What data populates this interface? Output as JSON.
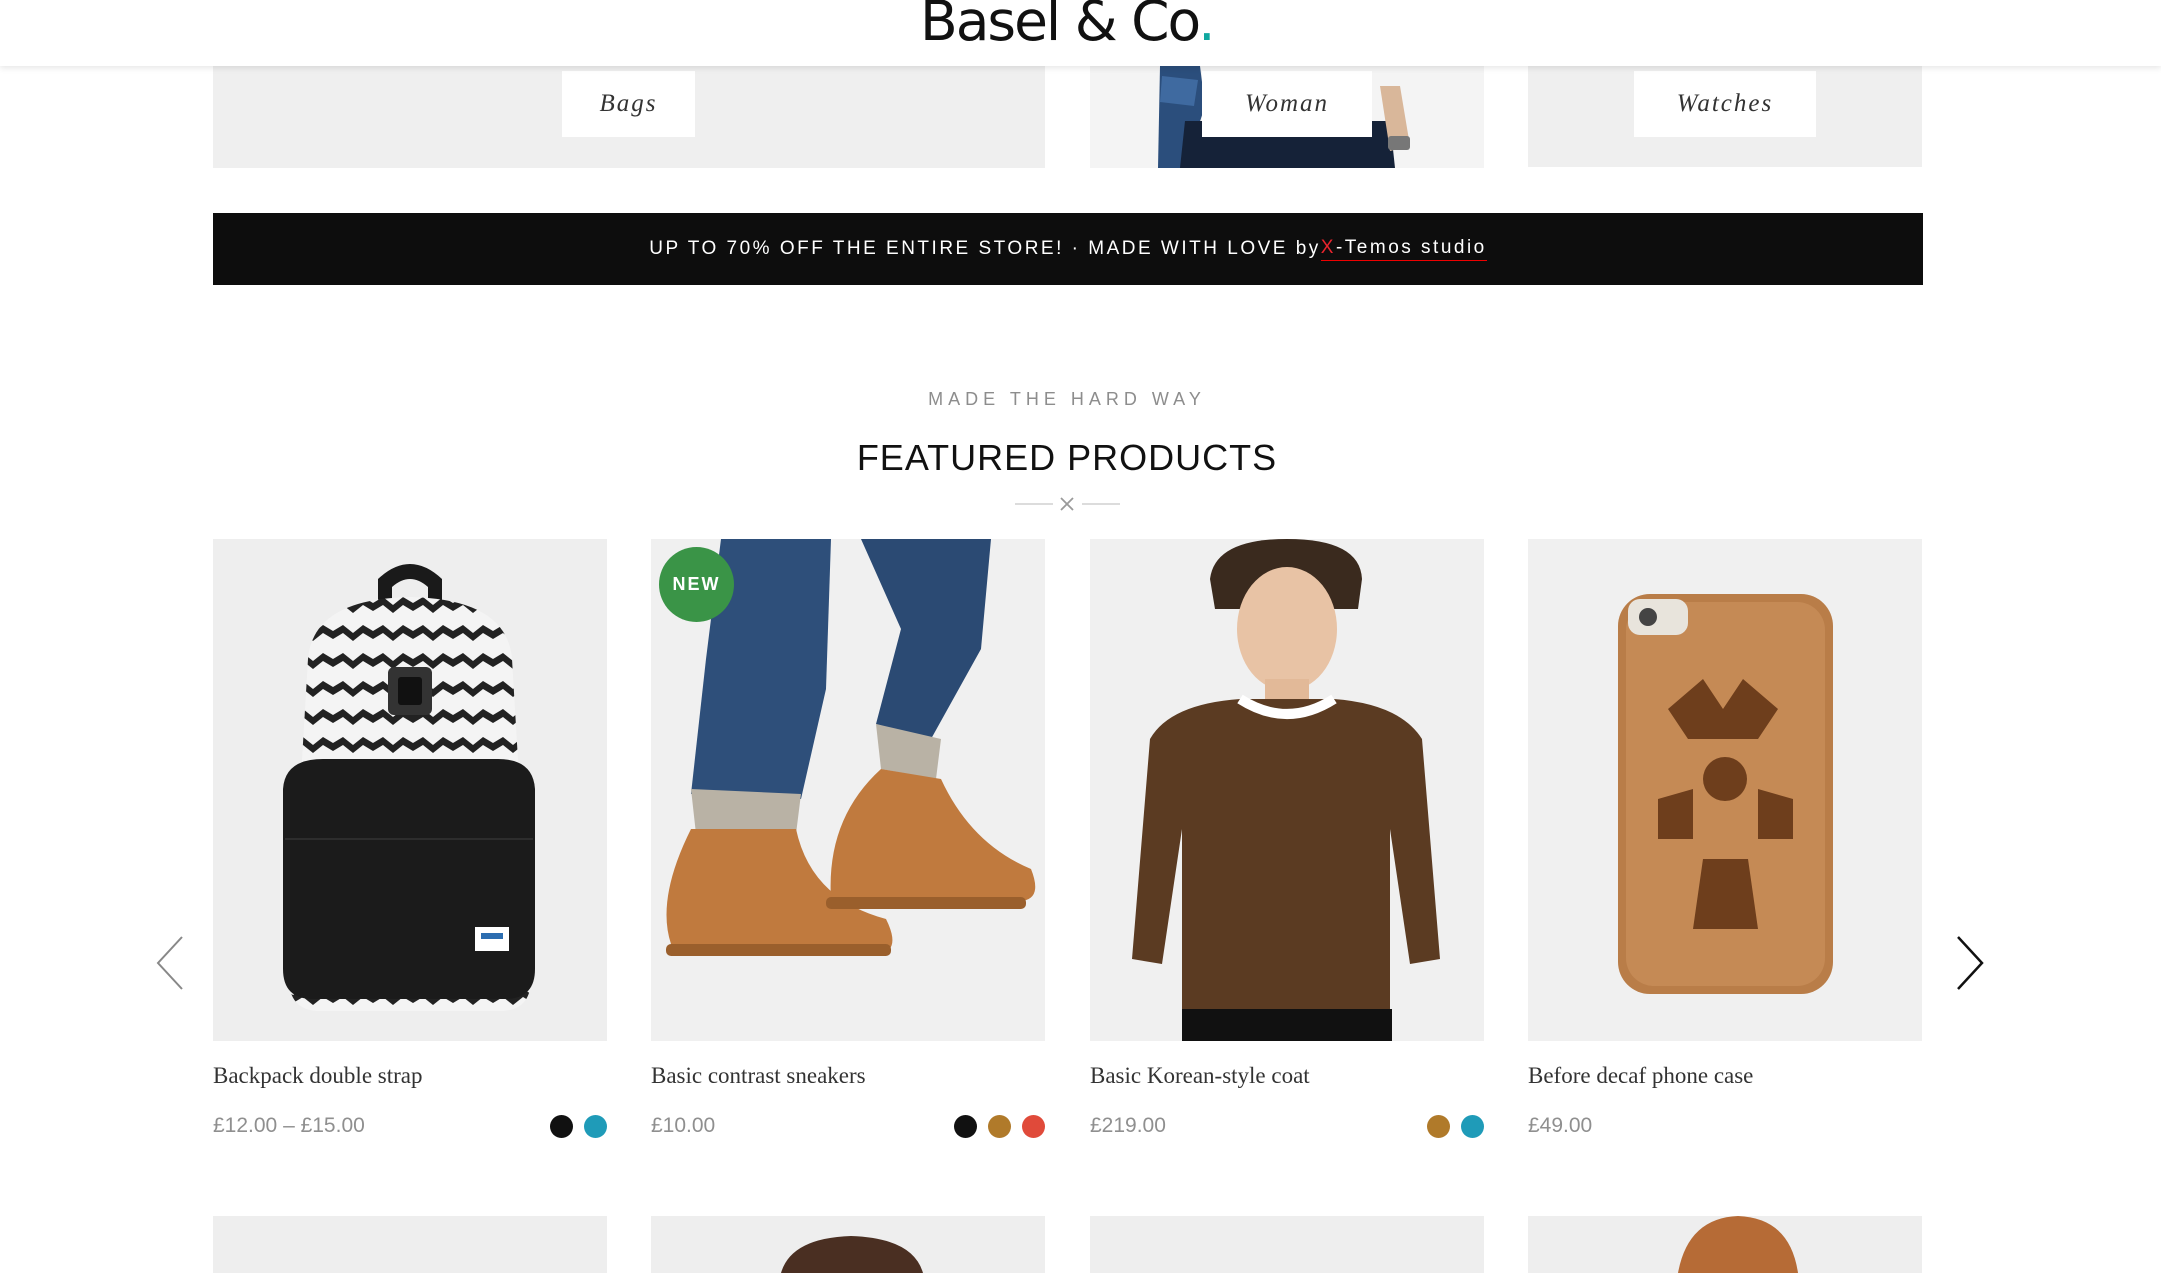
{
  "header": {
    "logo_main": "Basel & Co",
    "logo_dot": "."
  },
  "categories": [
    {
      "label": "Bags"
    },
    {
      "label": "Woman"
    },
    {
      "label": "Watches"
    }
  ],
  "promo": {
    "text": "UP TO 70% OFF THE ENTIRE STORE! · MADE WITH LOVE by ",
    "studio_x": "X",
    "studio_rest": "-Temos studio"
  },
  "section": {
    "subtitle": "MADE THE HARD WAY",
    "title": "FEATURED PRODUCTS"
  },
  "products": [
    {
      "name": "Backpack double strap",
      "price": "£12.00 – £15.00",
      "swatches": [
        "#111111",
        "#1f9bb8"
      ]
    },
    {
      "name": "Basic contrast sneakers",
      "price": "£10.00",
      "badge": "NEW",
      "swatches": [
        "#111111",
        "#b07a2a",
        "#e04a3a"
      ]
    },
    {
      "name": "Basic Korean-style coat",
      "price": "£219.00",
      "swatches": [
        "#b07a2a",
        "#1f9bb8"
      ]
    },
    {
      "name": "Before decaf phone case",
      "price": "£49.00",
      "swatches": []
    }
  ],
  "colors": {
    "accent": "#10a8a0",
    "badge": "#3a9447",
    "promo_bg": "#0d0d0d",
    "studio_red": "#e8242d"
  },
  "icons": [
    "chevron-left-icon",
    "chevron-right-icon",
    "close-x-icon"
  ]
}
